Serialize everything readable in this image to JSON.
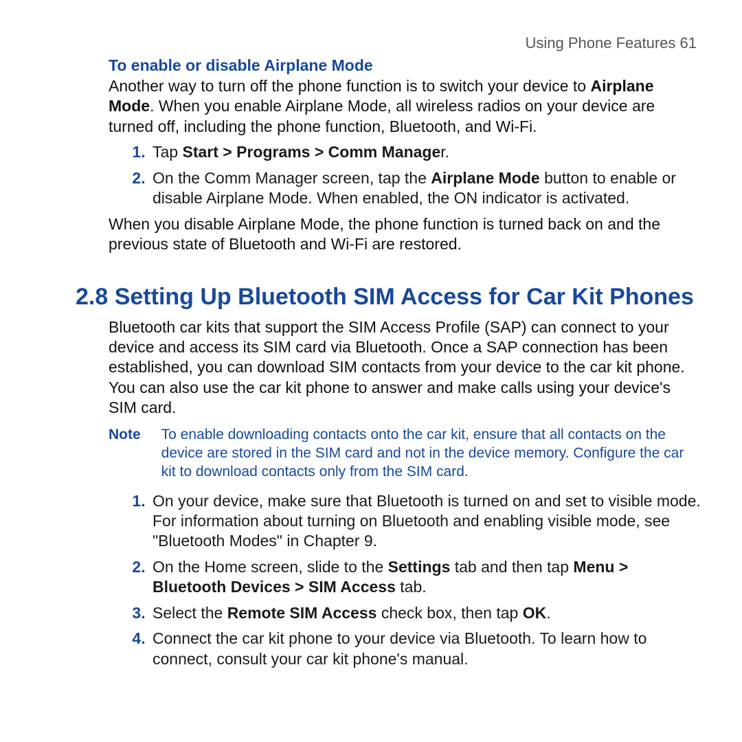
{
  "running_head": "Using Phone Features  61",
  "airplane": {
    "subheading": "To enable or disable Airplane Mode",
    "intro_pre": "Another way to turn off the phone function is to switch your device to ",
    "intro_bold": "Airplane Mode",
    "intro_post": ". When you enable Airplane Mode, all wireless radios on your device are turned off, including the phone function, Bluetooth, and Wi-Fi.",
    "step1_pre": "Tap ",
    "step1_bold": "Start > Programs > Comm Manage",
    "step1_post": "r.",
    "step2_pre": "On the Comm Manager screen, tap the ",
    "step2_bold": "Airplane Mode",
    "step2_post": " button to enable or disable Airplane Mode. When enabled, the ON indicator is activated.",
    "closing": "When you disable Airplane Mode, the phone function is turned back on and the previous state of Bluetooth and Wi-Fi are restored."
  },
  "section": {
    "title": "2.8 Setting Up Bluetooth SIM Access for Car Kit Phones",
    "intro": "Bluetooth car kits that support the SIM Access Profile (SAP) can connect to your device and access its SIM card via Bluetooth. Once a SAP connection has been established, you can download SIM contacts from your device to the car kit phone. You can also use the car kit phone to answer and make calls using your device's SIM card.",
    "note_label": "Note",
    "note_text": "To enable downloading contacts onto the car kit, ensure that all contacts on the device are stored in the SIM card and not in the device memory. Configure the car kit to download contacts only from the SIM card.",
    "s1": "On your device, make sure that Bluetooth is turned on and set to visible mode. For information about turning on Bluetooth and enabling visible mode, see \"Bluetooth Modes\" in Chapter 9.",
    "s2_pre": "On the Home screen, slide to the ",
    "s2_b1": "Settings",
    "s2_mid1": " tab and then tap ",
    "s2_b2": "Menu > Bluetooth Devices > SIM Access",
    "s2_post": " tab.",
    "s3_pre": "Select the ",
    "s3_b1": "Remote SIM Access",
    "s3_mid": " check box, then tap ",
    "s3_b2": "OK",
    "s3_post": ".",
    "s4": "Connect the car kit phone to your device via Bluetooth. To learn how to connect, consult your car kit phone's manual."
  }
}
